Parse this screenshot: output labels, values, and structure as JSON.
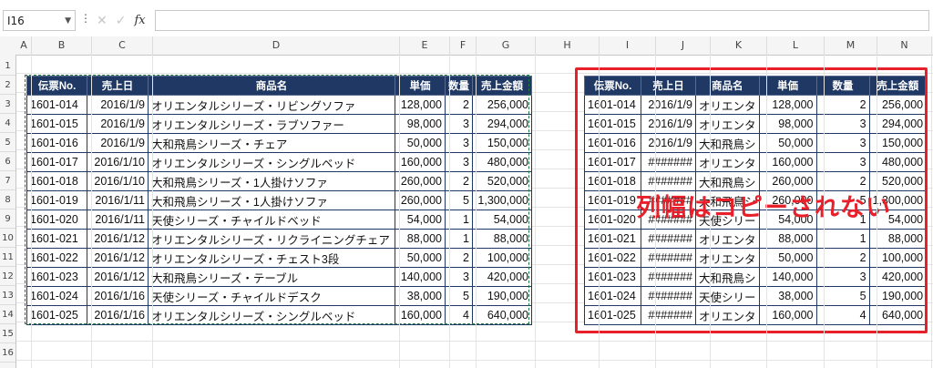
{
  "formula_bar": {
    "cell_ref": "I16",
    "fx_label": "fx",
    "cancel": "✕",
    "confirm": "✓",
    "dots": "⋮"
  },
  "columns": [
    {
      "label": "A",
      "w": 17
    },
    {
      "label": "B",
      "w": 66
    },
    {
      "label": "C",
      "w": 67
    },
    {
      "label": "D",
      "w": 271
    },
    {
      "label": "E",
      "w": 55
    },
    {
      "label": "F",
      "w": 29
    },
    {
      "label": "G",
      "w": 65
    },
    {
      "label": "H",
      "w": 70
    },
    {
      "label": "I",
      "w": 62
    },
    {
      "label": "J",
      "w": 60
    },
    {
      "label": "K",
      "w": 62
    },
    {
      "label": "L",
      "w": 63
    },
    {
      "label": "M",
      "w": 58
    },
    {
      "label": "N",
      "w": 60
    }
  ],
  "rows": [
    "1",
    "2",
    "3",
    "4",
    "5",
    "6",
    "7",
    "8",
    "9",
    "10",
    "11",
    "12",
    "13",
    "14",
    "15",
    "16"
  ],
  "table_left": {
    "headers": [
      "伝票No.",
      "売上日",
      "商品名",
      "単価",
      "数量",
      "売上金額"
    ],
    "rows": [
      [
        "1601-014",
        "2016/1/9",
        "オリエンタルシリーズ・リビングソファ",
        "128,000",
        "2",
        "256,000"
      ],
      [
        "1601-015",
        "2016/1/9",
        "オリエンタルシリーズ・ラブソファー",
        "98,000",
        "3",
        "294,000"
      ],
      [
        "1601-016",
        "2016/1/9",
        "大和飛鳥シリーズ・チェア",
        "50,000",
        "3",
        "150,000"
      ],
      [
        "1601-017",
        "2016/1/10",
        "オリエンタルシリーズ・シングルベッド",
        "160,000",
        "3",
        "480,000"
      ],
      [
        "1601-018",
        "2016/1/10",
        "大和飛鳥シリーズ・1人掛けソファ",
        "260,000",
        "2",
        "520,000"
      ],
      [
        "1601-019",
        "2016/1/11",
        "大和飛鳥シリーズ・1人掛けソファ",
        "260,000",
        "5",
        "1,300,000"
      ],
      [
        "1601-020",
        "2016/1/11",
        "天使シリーズ・チャイルドベッド",
        "54,000",
        "1",
        "54,000"
      ],
      [
        "1601-021",
        "2016/1/12",
        "オリエンタルシリーズ・リクライニングチェア",
        "88,000",
        "1",
        "88,000"
      ],
      [
        "1601-022",
        "2016/1/12",
        "オリエンタルシリーズ・チェスト3段",
        "50,000",
        "2",
        "100,000"
      ],
      [
        "1601-023",
        "2016/1/12",
        "大和飛鳥シリーズ・テーブル",
        "140,000",
        "3",
        "420,000"
      ],
      [
        "1601-024",
        "2016/1/16",
        "天使シリーズ・チャイルドデスク",
        "38,000",
        "5",
        "190,000"
      ],
      [
        "1601-025",
        "2016/1/16",
        "オリエンタルシリーズ・シングルベッド",
        "160,000",
        "4",
        "640,000"
      ]
    ]
  },
  "table_right": {
    "headers": [
      "伝票No.",
      "売上日",
      "商品名",
      "単価",
      "数量",
      "売上金額"
    ],
    "rows": [
      [
        "1601-014",
        "2016/1/9",
        "オリエンタ",
        "128,000",
        "2",
        "256,000"
      ],
      [
        "1601-015",
        "2016/1/9",
        "オリエンタ",
        "98,000",
        "3",
        "294,000"
      ],
      [
        "1601-016",
        "2016/1/9",
        "大和飛鳥シ",
        "50,000",
        "3",
        "150,000"
      ],
      [
        "1601-017",
        "#######",
        "オリエンタ",
        "160,000",
        "3",
        "480,000"
      ],
      [
        "1601-018",
        "#######",
        "大和飛鳥シ",
        "260,000",
        "2",
        "520,000"
      ],
      [
        "1601-019",
        "#######",
        "大和飛鳥シ",
        "260,000",
        "5",
        "1,300,000"
      ],
      [
        "1601-020",
        "#######",
        "天使シリー",
        "54,000",
        "1",
        "54,000"
      ],
      [
        "1601-021",
        "#######",
        "オリエンタ",
        "88,000",
        "1",
        "88,000"
      ],
      [
        "1601-022",
        "#######",
        "オリエンタ",
        "50,000",
        "2",
        "100,000"
      ],
      [
        "1601-023",
        "#######",
        "大和飛鳥シ",
        "140,000",
        "3",
        "420,000"
      ],
      [
        "1601-024",
        "#######",
        "天使シリー",
        "38,000",
        "5",
        "190,000"
      ],
      [
        "1601-025",
        "#######",
        "オリエンタ",
        "160,000",
        "4",
        "640,000"
      ]
    ]
  },
  "annotation": "列幅はコピーされない",
  "colors": {
    "header_fill": "#1f3864",
    "annotation": "#e8202a",
    "marquee": "#1e7a45"
  }
}
